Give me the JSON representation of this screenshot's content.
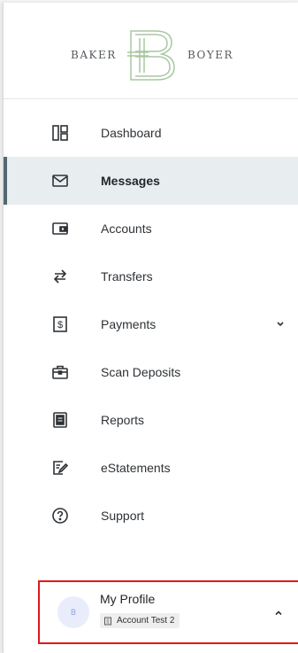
{
  "brand": {
    "left_word": "BAKER",
    "right_word": "BOYER",
    "monogram_letter": "B",
    "monogram_color": "#a9c7a0"
  },
  "nav": {
    "items": [
      {
        "label": "Dashboard",
        "icon": "dashboard-icon",
        "active": false
      },
      {
        "label": "Messages",
        "icon": "envelope-icon",
        "active": true
      },
      {
        "label": "Accounts",
        "icon": "wallet-icon",
        "active": false
      },
      {
        "label": "Transfers",
        "icon": "transfer-arrows-icon",
        "active": false
      },
      {
        "label": "Payments",
        "icon": "dollar-receipt-icon",
        "active": false,
        "has_submenu": true
      },
      {
        "label": "Scan Deposits",
        "icon": "briefcase-icon",
        "active": false
      },
      {
        "label": "Reports",
        "icon": "report-icon",
        "active": false
      },
      {
        "label": "eStatements",
        "icon": "edit-document-icon",
        "active": false
      },
      {
        "label": "Support",
        "icon": "help-circle-icon",
        "active": false
      }
    ],
    "active_color": "#546773",
    "active_bg": "#e8edf0"
  },
  "profile": {
    "avatar_letter": "B",
    "name": "My Profile",
    "account": "Account Test 2",
    "highlight_color": "#e01818"
  }
}
